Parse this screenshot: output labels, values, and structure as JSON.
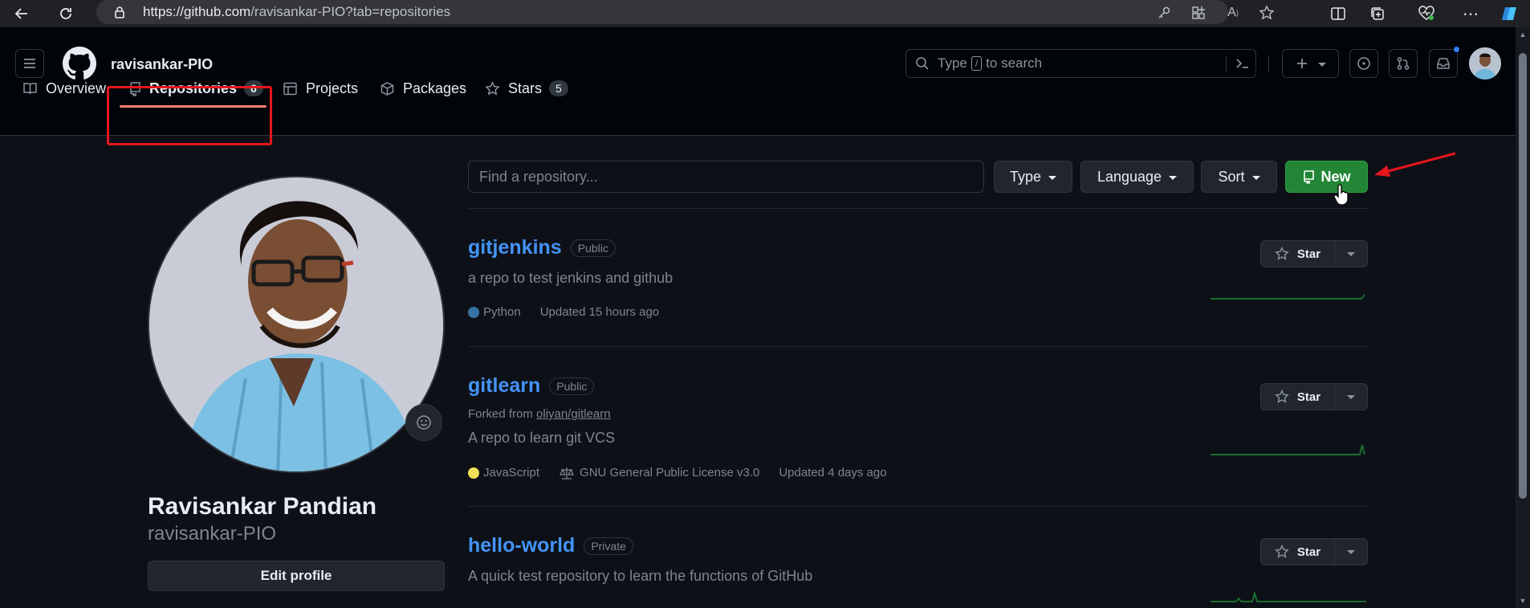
{
  "browser": {
    "url_host": "https://github.com",
    "url_path": "/ravisankar-PIO?tab=repositories"
  },
  "header": {
    "username": "ravisankar-PIO",
    "search_pre": "Type",
    "search_key": "/",
    "search_post": "to search"
  },
  "tabs": [
    {
      "label": "Overview"
    },
    {
      "label": "Repositories",
      "count": "6",
      "selected": true
    },
    {
      "label": "Projects"
    },
    {
      "label": "Packages"
    },
    {
      "label": "Stars",
      "count": "5"
    }
  ],
  "profile": {
    "full_name": "Ravisankar Pandian",
    "login": "ravisankar-PIO",
    "edit_button": "Edit profile"
  },
  "filters": {
    "find_placeholder": "Find a repository...",
    "type_label": "Type",
    "language_label": "Language",
    "sort_label": "Sort",
    "new_label": "New"
  },
  "repos": [
    {
      "name": "gitjenkins",
      "visibility": "Public",
      "description": "a repo to test jenkins and github",
      "language": "Python",
      "language_color": "#3572A5",
      "updated": "Updated 15 hours ago",
      "star_label": "Star"
    },
    {
      "name": "gitlearn",
      "visibility": "Public",
      "forked_prefix": "Forked from",
      "forked_from": "oliyan/gitlearn",
      "description": "A repo to learn git VCS",
      "language": "JavaScript",
      "language_color": "#f1e05a",
      "license": "GNU General Public License v3.0",
      "updated": "Updated 4 days ago",
      "star_label": "Star"
    },
    {
      "name": "hello-world",
      "visibility": "Private",
      "description": "A quick test repository to learn the functions of GitHub",
      "star_label": "Star"
    }
  ],
  "colors": {
    "accent_green": "#238636",
    "link_blue": "#4493f8",
    "highlight_red": "#e5161c"
  }
}
